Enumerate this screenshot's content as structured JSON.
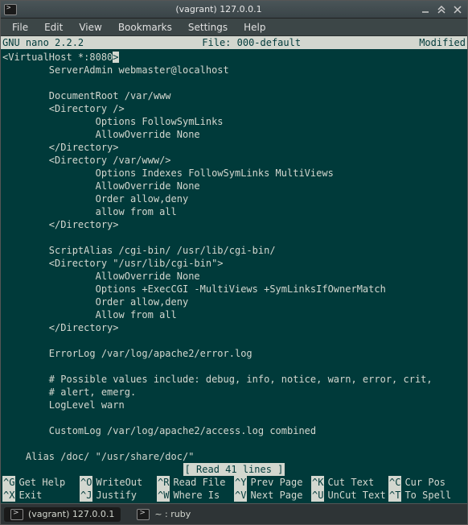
{
  "window": {
    "title": "(vagrant) 127.0.0.1"
  },
  "menu": {
    "file": "File",
    "edit": "Edit",
    "view": "View",
    "bookmarks": "Bookmarks",
    "settings": "Settings",
    "help": "Help"
  },
  "nano": {
    "version": "  GNU nano 2.2.2",
    "file_label": "File: 000-default",
    "modified": "Modified  ",
    "status": "[ Read 41 lines ]",
    "content_pre": "<VirtualHost *:8080",
    "cursor": ">",
    "content_post": "\n        ServerAdmin webmaster@localhost\n\n        DocumentRoot /var/www\n        <Directory />\n                Options FollowSymLinks\n                AllowOverride None\n        </Directory>\n        <Directory /var/www/>\n                Options Indexes FollowSymLinks MultiViews\n                AllowOverride None\n                Order allow,deny\n                allow from all\n        </Directory>\n\n        ScriptAlias /cgi-bin/ /usr/lib/cgi-bin/\n        <Directory \"/usr/lib/cgi-bin\">\n                AllowOverride None\n                Options +ExecCGI -MultiViews +SymLinksIfOwnerMatch\n                Order allow,deny\n                Allow from all\n        </Directory>\n\n        ErrorLog /var/log/apache2/error.log\n\n        # Possible values include: debug, info, notice, warn, error, crit,\n        # alert, emerg.\n        LogLevel warn\n\n        CustomLog /var/log/apache2/access.log combined\n\n    Alias /doc/ \"/usr/share/doc/\"\n    <Directory \"/usr/share/doc/\">",
    "help": {
      "row1": [
        {
          "key": "^G",
          "label": "Get Help"
        },
        {
          "key": "^O",
          "label": "WriteOut"
        },
        {
          "key": "^R",
          "label": "Read File"
        },
        {
          "key": "^Y",
          "label": "Prev Page"
        },
        {
          "key": "^K",
          "label": "Cut Text"
        },
        {
          "key": "^C",
          "label": "Cur Pos"
        }
      ],
      "row2": [
        {
          "key": "^X",
          "label": "Exit"
        },
        {
          "key": "^J",
          "label": "Justify"
        },
        {
          "key": "^W",
          "label": "Where Is"
        },
        {
          "key": "^V",
          "label": "Next Page"
        },
        {
          "key": "^U",
          "label": "UnCut Text"
        },
        {
          "key": "^T",
          "label": "To Spell"
        }
      ]
    }
  },
  "taskbar": {
    "task1": "(vagrant) 127.0.0.1",
    "task2": "~ : ruby"
  }
}
